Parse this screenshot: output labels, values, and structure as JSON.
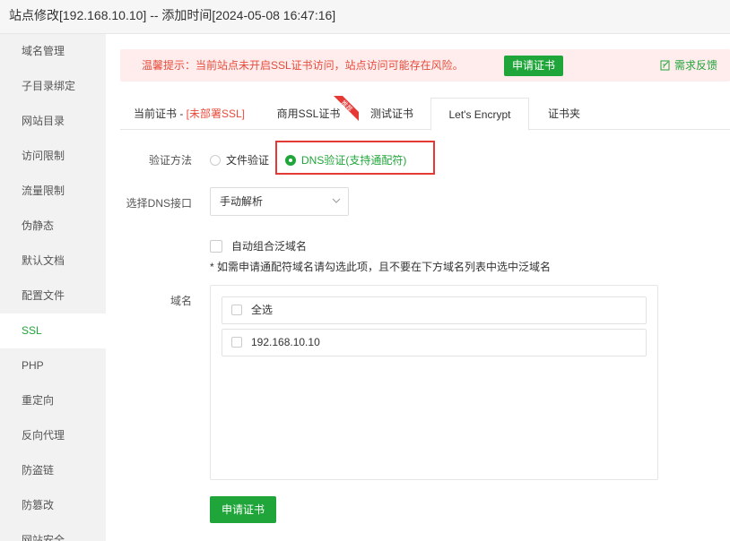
{
  "window": {
    "title": "站点修改[192.168.10.10] -- 添加时间[2024-05-08 16:47:16]"
  },
  "sidebar": {
    "items": [
      {
        "label": "域名管理"
      },
      {
        "label": "子目录绑定"
      },
      {
        "label": "网站目录"
      },
      {
        "label": "访问限制"
      },
      {
        "label": "流量限制"
      },
      {
        "label": "伪静态"
      },
      {
        "label": "默认文档"
      },
      {
        "label": "配置文件"
      },
      {
        "label": "SSL"
      },
      {
        "label": "PHP"
      },
      {
        "label": "重定向"
      },
      {
        "label": "反向代理"
      },
      {
        "label": "防盗链"
      },
      {
        "label": "防篡改"
      },
      {
        "label": "网站安全"
      }
    ],
    "active_index": 8
  },
  "warning": {
    "text": "温馨提示：当前站点未开启SSL证书访问，站点访问可能存在风险。",
    "button": "申请证书",
    "feedback": "需求反馈"
  },
  "tabs": {
    "current_prefix": "当前证书 - ",
    "current_status": "[未部署SSL]",
    "commercial": "商用SSL证书",
    "ribbon": "推荐",
    "test": "测试证书",
    "letsencrypt": "Let's Encrypt",
    "folder": "证书夹"
  },
  "form": {
    "verify_label": "验证方法",
    "file_verify": "文件验证",
    "dns_verify": "DNS验证(支持通配符)",
    "dns_api_label": "选择DNS接口",
    "dns_api_value": "手动解析",
    "wildcard_label": "自动组合泛域名",
    "wildcard_hint": "* 如需申请通配符域名请勾选此项，且不要在下方域名列表中选中泛域名",
    "domain_label": "域名",
    "domains": [
      {
        "label": "全选"
      },
      {
        "label": "192.168.10.10"
      }
    ],
    "apply_button": "申请证书"
  },
  "colors": {
    "accent": "#20a53a",
    "danger": "#e64c3c",
    "highlight": "#e53935"
  }
}
